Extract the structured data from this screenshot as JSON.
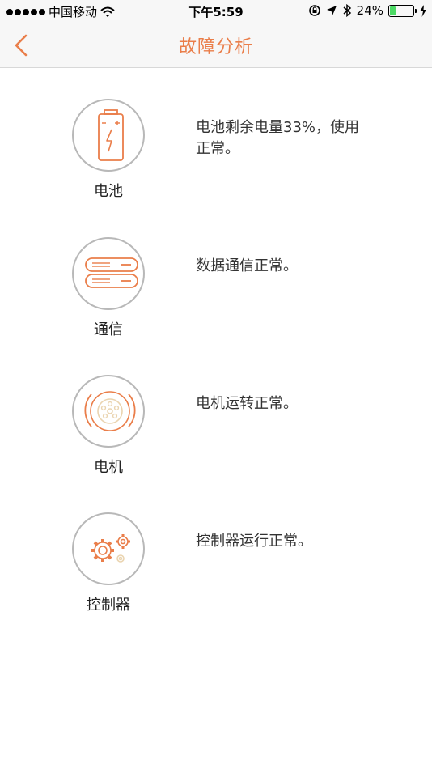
{
  "status_bar": {
    "carrier": "中国移动",
    "time": "下午5:59",
    "battery_percent": "24%",
    "battery_level": 0.24,
    "icons": [
      "wifi-icon",
      "orientation-lock-icon",
      "location-arrow-icon",
      "bluetooth-icon",
      "battery-icon",
      "charging-bolt-icon"
    ]
  },
  "nav": {
    "title": "故障分析",
    "back_icon": "chevron-left-icon"
  },
  "colors": {
    "accent": "#ea7e4a",
    "circle_border": "#b8b8b8",
    "text": "#222222"
  },
  "items": [
    {
      "label": "电池",
      "status": "电池剩余电量33%，使用正常。",
      "icon": "battery-icon"
    },
    {
      "label": "通信",
      "status": "数据通信正常。",
      "icon": "server-icon"
    },
    {
      "label": "电机",
      "status": "电机运转正常。",
      "icon": "motor-icon"
    },
    {
      "label": "控制器",
      "status": "控制器运行正常。",
      "icon": "gears-icon"
    }
  ]
}
